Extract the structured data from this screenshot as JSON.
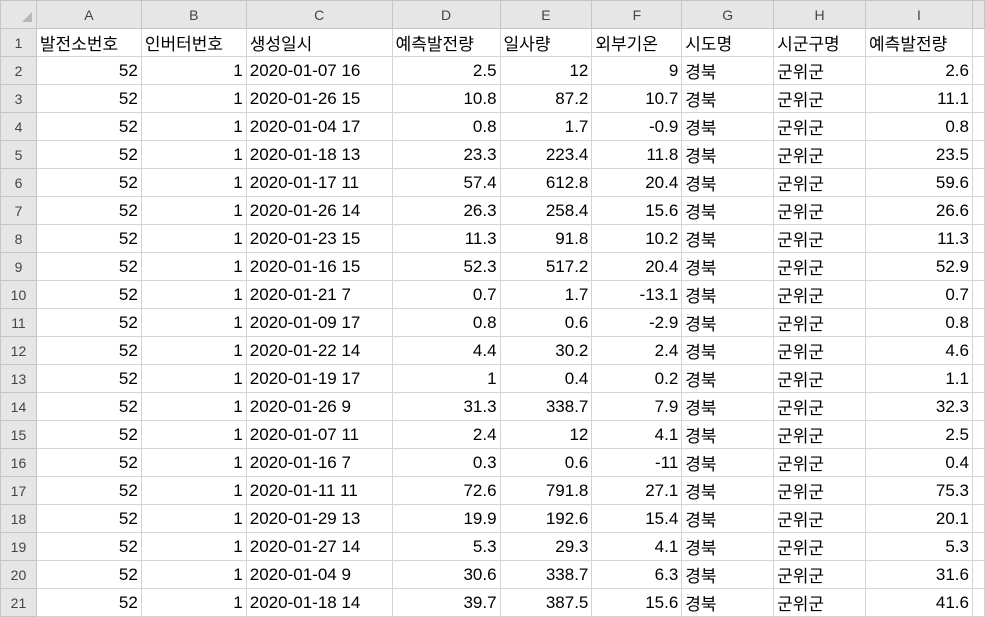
{
  "columns": [
    "A",
    "B",
    "C",
    "D",
    "E",
    "F",
    "G",
    "H",
    "I"
  ],
  "header_row": {
    "row": "1",
    "cells": [
      "발전소번호",
      "인버터번호",
      "생성일시",
      "예측발전량",
      "일사량",
      "외부기온",
      "시도명",
      "시군구명",
      "예측발전량"
    ]
  },
  "rows": [
    {
      "row": "2",
      "cells": [
        "52",
        "1",
        "2020-01-07 16",
        "2.5",
        "12",
        "9",
        "경북",
        "군위군",
        "2.6"
      ]
    },
    {
      "row": "3",
      "cells": [
        "52",
        "1",
        "2020-01-26 15",
        "10.8",
        "87.2",
        "10.7",
        "경북",
        "군위군",
        "11.1"
      ]
    },
    {
      "row": "4",
      "cells": [
        "52",
        "1",
        "2020-01-04 17",
        "0.8",
        "1.7",
        "-0.9",
        "경북",
        "군위군",
        "0.8"
      ]
    },
    {
      "row": "5",
      "cells": [
        "52",
        "1",
        "2020-01-18 13",
        "23.3",
        "223.4",
        "11.8",
        "경북",
        "군위군",
        "23.5"
      ]
    },
    {
      "row": "6",
      "cells": [
        "52",
        "1",
        "2020-01-17 11",
        "57.4",
        "612.8",
        "20.4",
        "경북",
        "군위군",
        "59.6"
      ]
    },
    {
      "row": "7",
      "cells": [
        "52",
        "1",
        "2020-01-26 14",
        "26.3",
        "258.4",
        "15.6",
        "경북",
        "군위군",
        "26.6"
      ]
    },
    {
      "row": "8",
      "cells": [
        "52",
        "1",
        "2020-01-23 15",
        "11.3",
        "91.8",
        "10.2",
        "경북",
        "군위군",
        "11.3"
      ]
    },
    {
      "row": "9",
      "cells": [
        "52",
        "1",
        "2020-01-16 15",
        "52.3",
        "517.2",
        "20.4",
        "경북",
        "군위군",
        "52.9"
      ]
    },
    {
      "row": "10",
      "cells": [
        "52",
        "1",
        "2020-01-21 7",
        "0.7",
        "1.7",
        "-13.1",
        "경북",
        "군위군",
        "0.7"
      ]
    },
    {
      "row": "11",
      "cells": [
        "52",
        "1",
        "2020-01-09 17",
        "0.8",
        "0.6",
        "-2.9",
        "경북",
        "군위군",
        "0.8"
      ]
    },
    {
      "row": "12",
      "cells": [
        "52",
        "1",
        "2020-01-22 14",
        "4.4",
        "30.2",
        "2.4",
        "경북",
        "군위군",
        "4.6"
      ]
    },
    {
      "row": "13",
      "cells": [
        "52",
        "1",
        "2020-01-19 17",
        "1",
        "0.4",
        "0.2",
        "경북",
        "군위군",
        "1.1"
      ]
    },
    {
      "row": "14",
      "cells": [
        "52",
        "1",
        "2020-01-26 9",
        "31.3",
        "338.7",
        "7.9",
        "경북",
        "군위군",
        "32.3"
      ]
    },
    {
      "row": "15",
      "cells": [
        "52",
        "1",
        "2020-01-07 11",
        "2.4",
        "12",
        "4.1",
        "경북",
        "군위군",
        "2.5"
      ]
    },
    {
      "row": "16",
      "cells": [
        "52",
        "1",
        "2020-01-16 7",
        "0.3",
        "0.6",
        "-11",
        "경북",
        "군위군",
        "0.4"
      ]
    },
    {
      "row": "17",
      "cells": [
        "52",
        "1",
        "2020-01-11 11",
        "72.6",
        "791.8",
        "27.1",
        "경북",
        "군위군",
        "75.3"
      ]
    },
    {
      "row": "18",
      "cells": [
        "52",
        "1",
        "2020-01-29 13",
        "19.9",
        "192.6",
        "15.4",
        "경북",
        "군위군",
        "20.1"
      ]
    },
    {
      "row": "19",
      "cells": [
        "52",
        "1",
        "2020-01-27 14",
        "5.3",
        "29.3",
        "4.1",
        "경북",
        "군위군",
        "5.3"
      ]
    },
    {
      "row": "20",
      "cells": [
        "52",
        "1",
        "2020-01-04 9",
        "30.6",
        "338.7",
        "6.3",
        "경북",
        "군위군",
        "31.6"
      ]
    },
    {
      "row": "21",
      "cells": [
        "52",
        "1",
        "2020-01-18 14",
        "39.7",
        "387.5",
        "15.6",
        "경북",
        "군위군",
        "41.6"
      ]
    }
  ]
}
